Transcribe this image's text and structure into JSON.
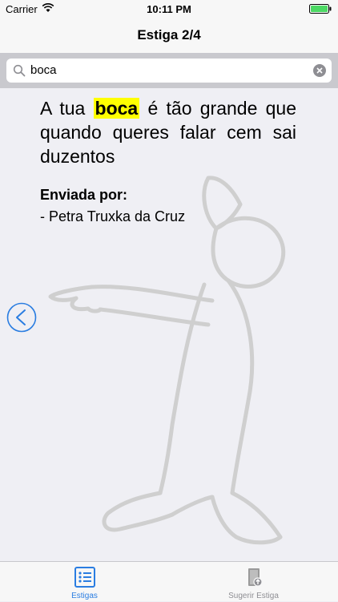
{
  "status_bar": {
    "carrier": "Carrier",
    "time": "10:11 PM"
  },
  "nav": {
    "title": "Estiga 2/4"
  },
  "search": {
    "value": "boca"
  },
  "quote": {
    "before": "A tua ",
    "highlight": "boca",
    "after": " é tão grande que quando queres falar cem sai duzentos"
  },
  "sender": {
    "label": "Enviada por:",
    "name": "- Petra Truxka da Cruz"
  },
  "tabs": [
    {
      "label": "Estigas",
      "icon": "list-icon",
      "active": true
    },
    {
      "label": "Sugerir Estiga",
      "icon": "suggest-icon",
      "active": false
    }
  ],
  "colors": {
    "accent": "#2a7de1",
    "highlight": "#ffff00",
    "background": "#efeff4"
  }
}
